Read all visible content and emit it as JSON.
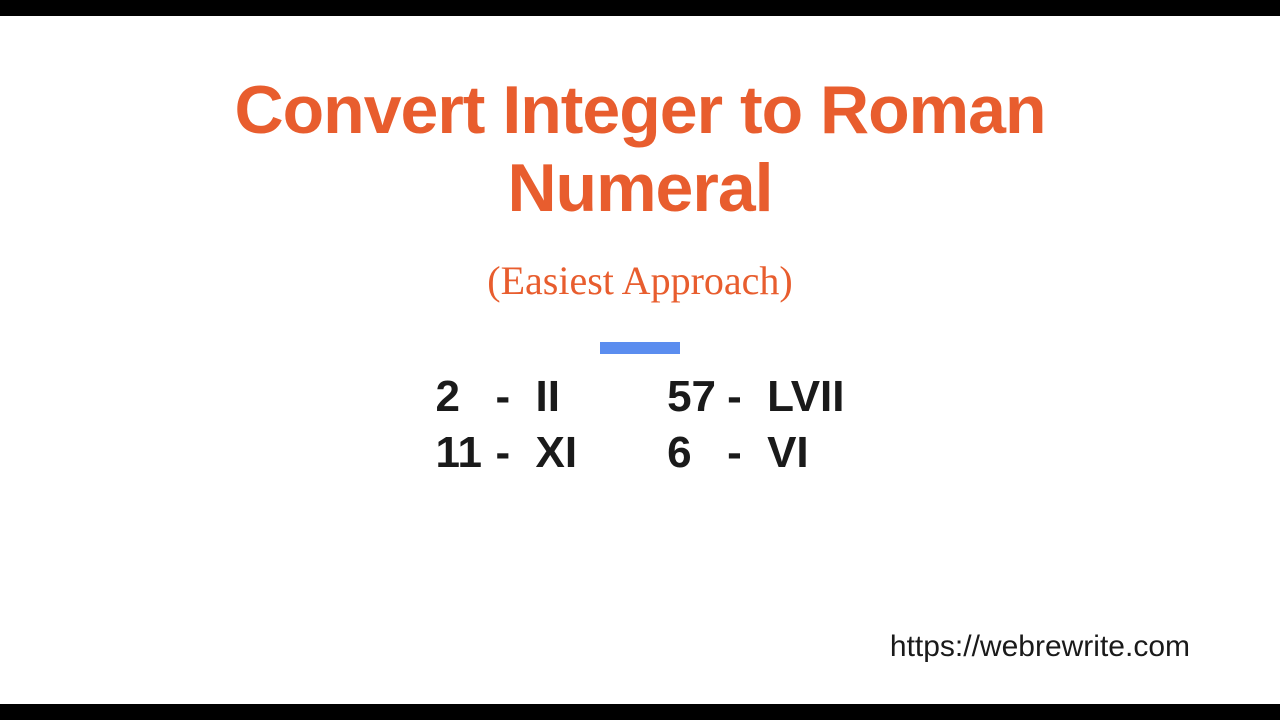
{
  "title_line1": "Convert Integer to Roman",
  "title_line2": "Numeral",
  "subtitle": "(Easiest Approach)",
  "examples": {
    "left": [
      {
        "num": "2",
        "roman": "II"
      },
      {
        "num": "11",
        "roman": "XI"
      }
    ],
    "right": [
      {
        "num": "57",
        "roman": "LVII"
      },
      {
        "num": "6",
        "roman": "VI"
      }
    ]
  },
  "url": "https://webrewrite.com"
}
